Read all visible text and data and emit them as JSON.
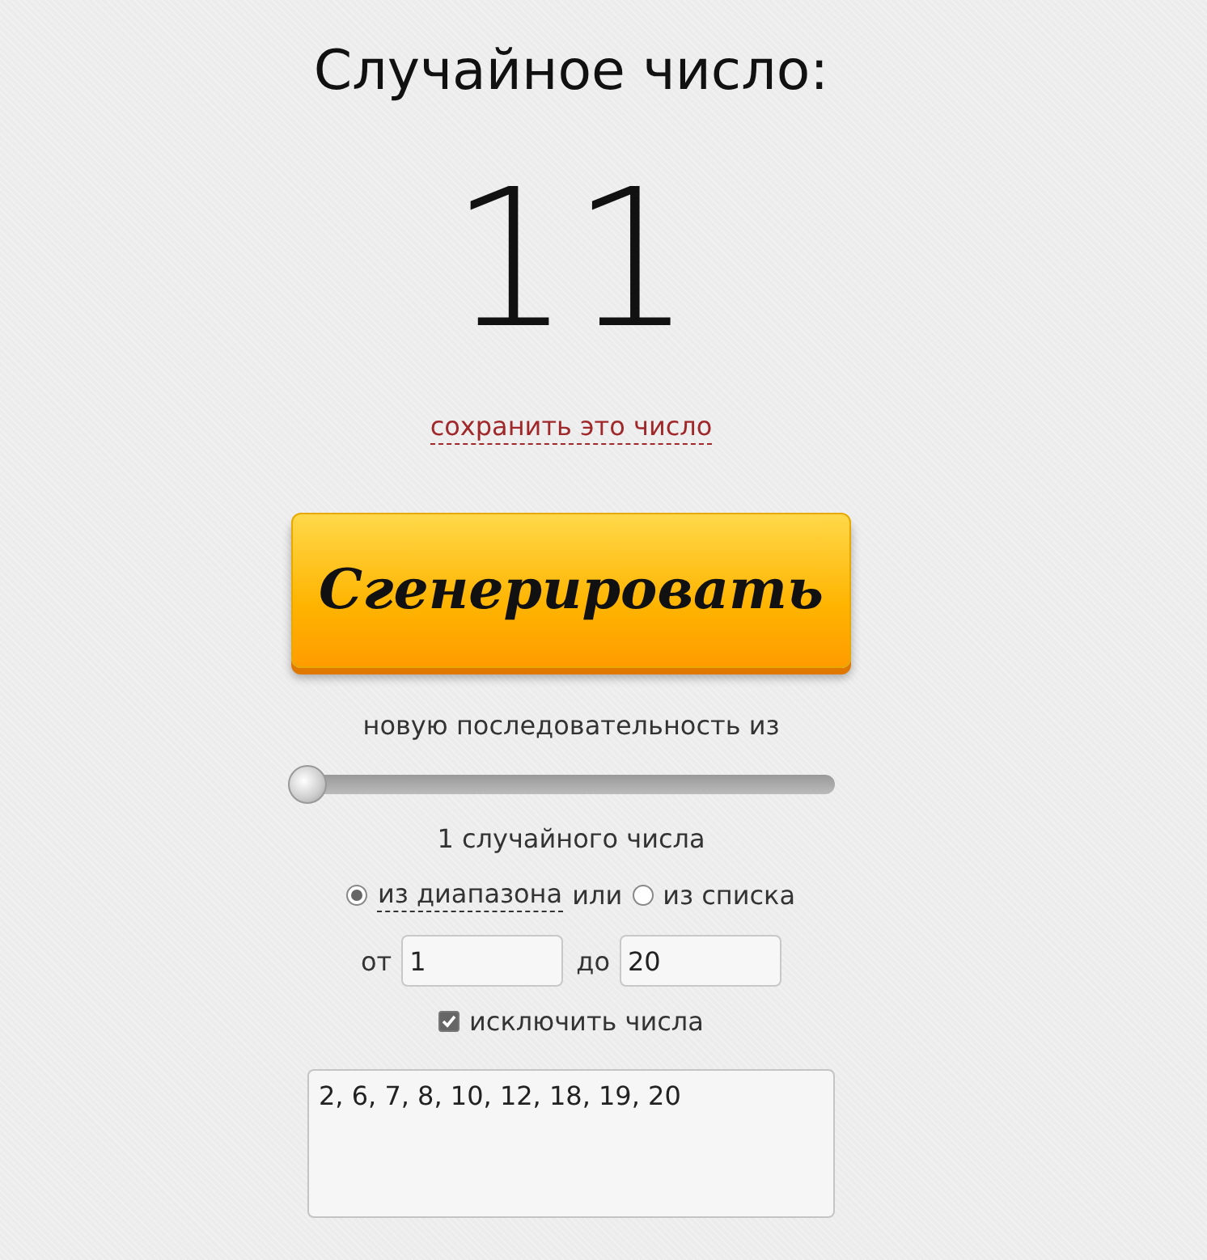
{
  "title": "Случайное число:",
  "result": "11",
  "save_link": "сохранить это число",
  "generate_button": "Сгенерировать",
  "sequence_label": "новую последовательность из",
  "count_slider": {
    "level": 0
  },
  "count_label": "1 случайного числа",
  "source_options": [
    {
      "label": "из диапазона",
      "selected": true,
      "kind": "link"
    },
    {
      "label": "из списка",
      "selected": false,
      "kind": "plain"
    }
  ],
  "source_separator": "или",
  "range": {
    "from_label": "от",
    "from_value": "1",
    "to_label": "до",
    "to_value": "20"
  },
  "exclude": {
    "label": "исключить числа",
    "checked": true
  },
  "excluded_numbers": "2, 6, 7, 8, 10, 12, 18, 19, 20"
}
